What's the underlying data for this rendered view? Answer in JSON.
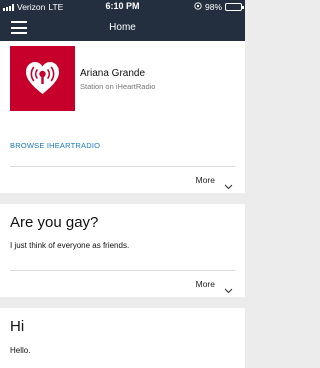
{
  "status_bar": {
    "carrier": "Verizon",
    "network": "LTE",
    "time": "6:10 PM",
    "battery": "98%"
  },
  "nav": {
    "title": "Home",
    "menu_icon": "hamburger-menu-icon"
  },
  "station_card": {
    "title": "Ariana Grande",
    "subtitle": "Station on iHeartRadio",
    "link": "BROWSE IHEARTRADIO",
    "more": "More",
    "logo_icon": "iheartradio-logo-icon",
    "brand_color": "#c6002b",
    "link_color": "#1a7ab8"
  },
  "qa_cards": [
    {
      "title": "Are you gay?",
      "body": "I just think of everyone as friends.",
      "more": "More"
    },
    {
      "title": "Hi",
      "body": "Hello."
    }
  ]
}
